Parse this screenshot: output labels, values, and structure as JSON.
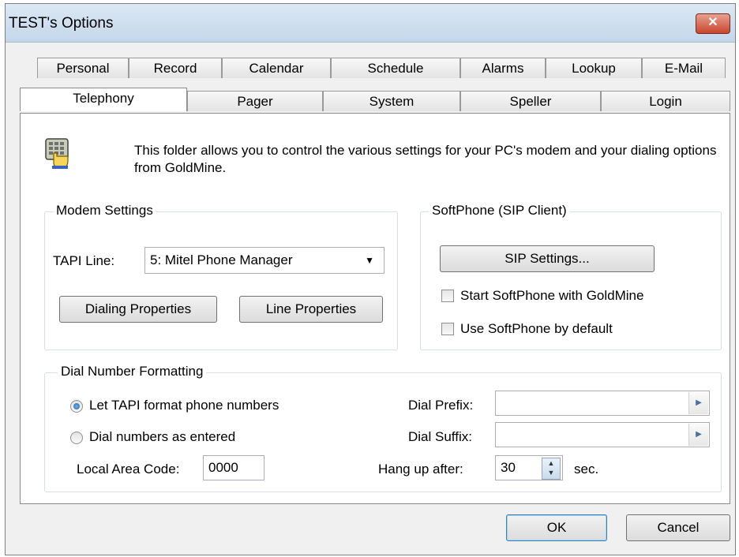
{
  "window": {
    "title": "TEST's Options",
    "close_glyph": "✕"
  },
  "tabs_row1": [
    "Personal",
    "Record",
    "Calendar",
    "Schedule",
    "Alarms",
    "Lookup",
    "E-Mail"
  ],
  "tabs_row2": [
    "Telephony",
    "Pager",
    "System",
    "Speller",
    "Login"
  ],
  "active_tab": "Telephony",
  "intro": {
    "icon": "keypad-hand-icon",
    "text": "This folder allows you to control the various settings for your PC's modem and your dialing options from GoldMine."
  },
  "modem": {
    "legend": "Modem Settings",
    "tapi_label": "TAPI Line:",
    "tapi_value": "5: Mitel Phone Manager",
    "dialing_btn": "Dialing Properties",
    "line_btn": "Line Properties"
  },
  "softphone": {
    "legend": "SoftPhone (SIP Client)",
    "sip_btn": "SIP Settings...",
    "start_label": "Start SoftPhone with GoldMine",
    "default_label": "Use SoftPhone by default"
  },
  "dial": {
    "legend": "Dial Number Formatting",
    "radio_tapi": "Let TAPI format phone numbers",
    "radio_entered": "Dial numbers as entered",
    "local_area_label": "Local Area Code:",
    "local_area_value": "0000",
    "prefix_label": "Dial Prefix:",
    "prefix_value": "",
    "suffix_label": "Dial Suffix:",
    "suffix_value": "",
    "hangup_label": "Hang up after:",
    "hangup_value": "30",
    "sec_label": "sec."
  },
  "footer": {
    "ok": "OK",
    "cancel": "Cancel"
  }
}
